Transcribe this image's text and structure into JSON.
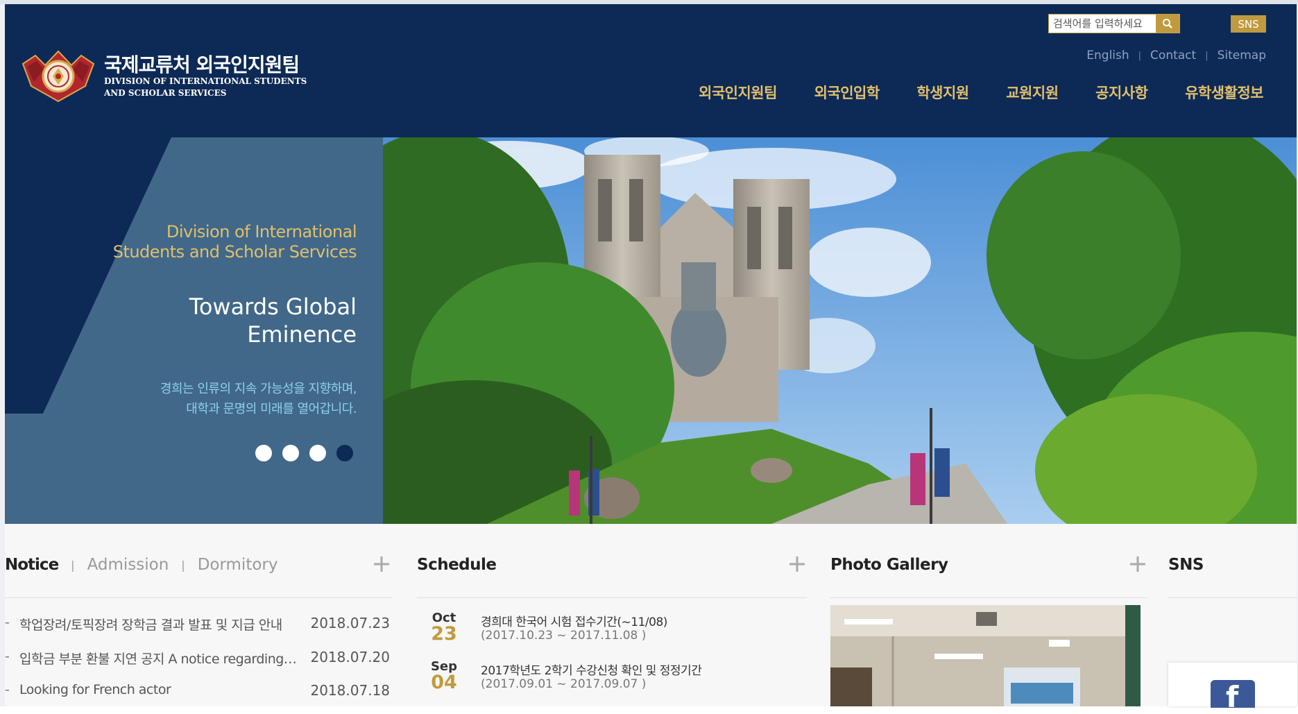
{
  "header": {
    "brand_ko": "국제교류처 외국인지원팀",
    "brand_en_line1": "DIVISION OF INTERNATIONAL STUDENTS",
    "brand_en_line2": "AND SCHOLAR SERVICES",
    "search_placeholder": "검색어를 입력하세요",
    "sns_label": "SNS",
    "utility_links": [
      "English",
      "Contact",
      "Sitemap"
    ],
    "nav": [
      "외국인지원팀",
      "외국인입학",
      "학생지원",
      "교원지원",
      "공지사항",
      "유학생활정보"
    ]
  },
  "hero": {
    "subtitle_line1": "Division of International",
    "subtitle_line2": "Students and Scholar Services",
    "title_line1": "Towards Global",
    "title_line2": "Eminence",
    "desc_line1": "경희는 인류의 지속 가능성을 지향하며,",
    "desc_line2": "대학과 문명의 미래를 열어갑니다.",
    "slide_count": 4,
    "active_slide": 4
  },
  "notice": {
    "tabs": [
      "Notice",
      "Admission",
      "Dormitory"
    ],
    "items": [
      {
        "bullet": "-",
        "title": "학업장려/토픽장려 장학금 결과 발표 및 지급 안내",
        "date": "2018.07.23"
      },
      {
        "bullet": "-",
        "title": "입학금 부분 환불 지연 공지 A notice regarding refund",
        "date": "2018.07.20"
      },
      {
        "bullet": "-",
        "title": "Looking for French actor",
        "date": "2018.07.18"
      }
    ]
  },
  "schedule": {
    "title": "Schedule",
    "items": [
      {
        "month": "Oct",
        "day": "23",
        "text": "경희대 한국어 시험 접수기간(~11/08)",
        "range": "(2017.10.23 ~ 2017.11.08 )"
      },
      {
        "month": "Sep",
        "day": "04",
        "text": "2017학년도 2학기 수강신청 확인 및 정정기간",
        "range": "(2017.09.01 ~ 2017.09.07 )"
      }
    ]
  },
  "gallery": {
    "title": "Photo Gallery"
  },
  "sns": {
    "title": "SNS"
  },
  "colors": {
    "navy": "#0d2a56",
    "gold": "#c39a3c",
    "hero_blue": "#3f6586",
    "sky_text": "#8fd1ee"
  }
}
